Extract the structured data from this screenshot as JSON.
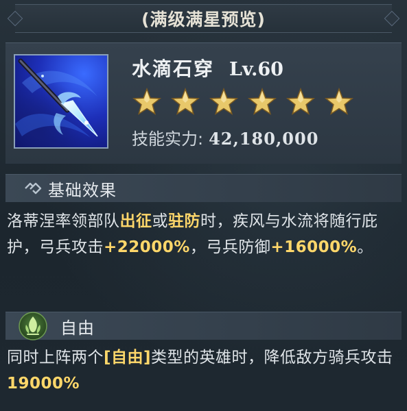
{
  "banner": {
    "title": "(满级满星预览)"
  },
  "skill": {
    "icon": "water-spear-icon",
    "name": "水滴石穿",
    "level": "Lv.60",
    "stars": 6,
    "star_color": "#e8c86a",
    "power_label": "技能实力:",
    "power_value": "42,180,000"
  },
  "basic_effect": {
    "icon": "link-chain-icon",
    "title": "基础效果",
    "text": {
      "p1": "洛蒂涅率领部队",
      "h1": "出征",
      "p2": "或",
      "h2": "驻防",
      "p3": "时，疾风与水流将随行庇护，弓兵攻击",
      "h3": "+22000%",
      "p4": "，弓兵防御",
      "h4": "+16000%",
      "p5": "。"
    }
  },
  "free_effect": {
    "icon": "leaf-flame-icon",
    "title": "自由",
    "text": {
      "p1": "同时上阵两个",
      "h1": "[自由]",
      "p2": "类型的英雄时，降低敌方骑兵攻击",
      "h2": "19000%"
    }
  },
  "colors": {
    "highlight": "#ffd76a",
    "panel_bg": "#1f2a33",
    "header_bg": "#35414d"
  }
}
